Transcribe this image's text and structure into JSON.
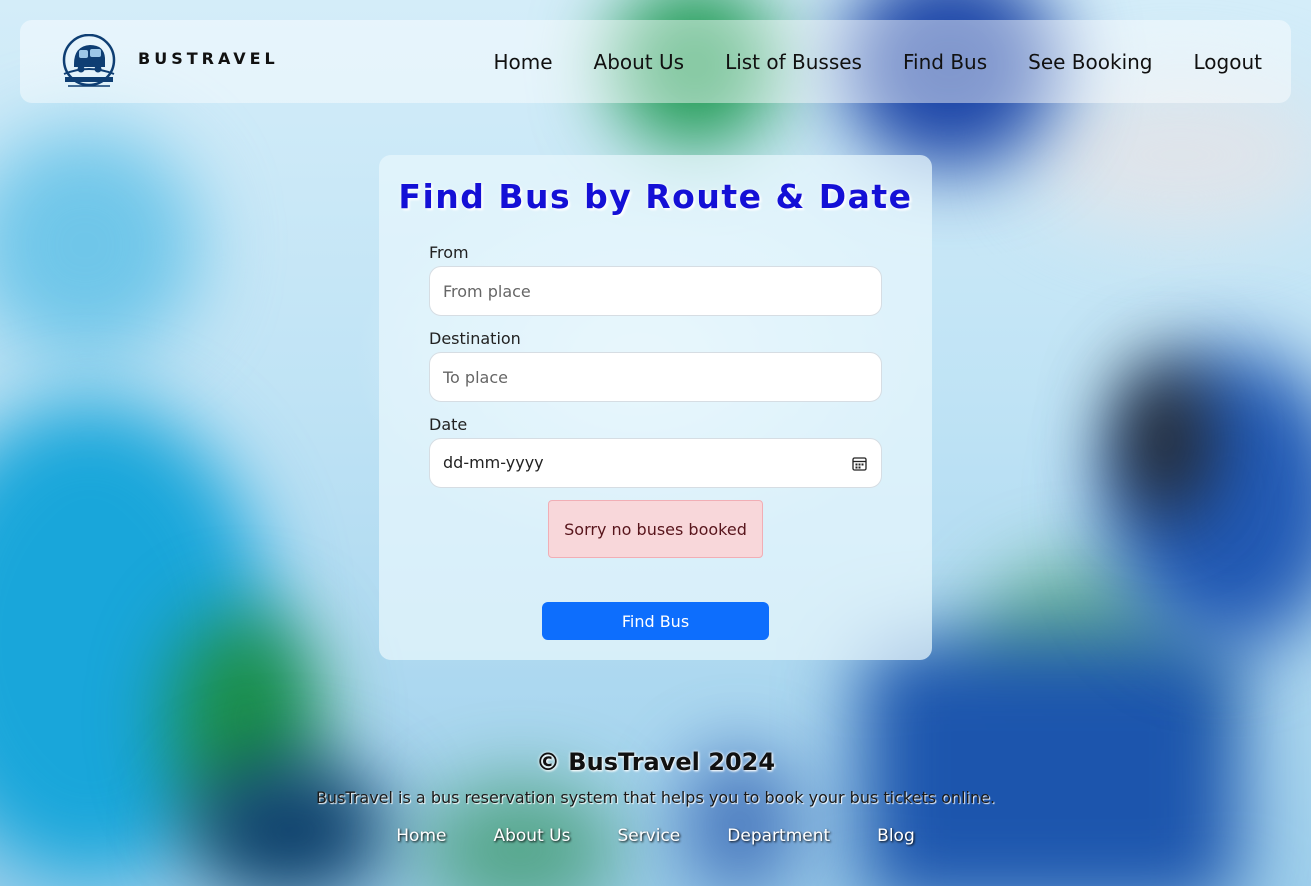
{
  "navbar": {
    "brand": "BUSTRAVEL",
    "logo_icon": "bus-logo-icon",
    "links": [
      {
        "label": "Home"
      },
      {
        "label": "About Us"
      },
      {
        "label": "List of Busses"
      },
      {
        "label": "Find Bus"
      },
      {
        "label": "See Booking"
      },
      {
        "label": "Logout"
      }
    ]
  },
  "form": {
    "title": "Find Bus by Route & Date",
    "from": {
      "label": "From",
      "placeholder": "From place",
      "value": ""
    },
    "destination": {
      "label": "Destination",
      "placeholder": "To place",
      "value": ""
    },
    "date": {
      "label": "Date",
      "value": "dd-mm-yyyy",
      "icon": "calendar-icon"
    },
    "alert": "Sorry no buses booked",
    "submit_label": "Find Bus"
  },
  "footer": {
    "copyright": "© BusTravel 2024",
    "description": "BusTravel is a bus reservation system that helps you to book your bus tickets online.",
    "links": [
      {
        "label": "Home"
      },
      {
        "label": "About Us"
      },
      {
        "label": "Service"
      },
      {
        "label": "Department"
      },
      {
        "label": "Blog"
      }
    ]
  },
  "colors": {
    "title_blue": "#1410d6",
    "button_blue": "#0d6efd",
    "alert_bg": "#f8d7da",
    "alert_text": "#58151c"
  }
}
